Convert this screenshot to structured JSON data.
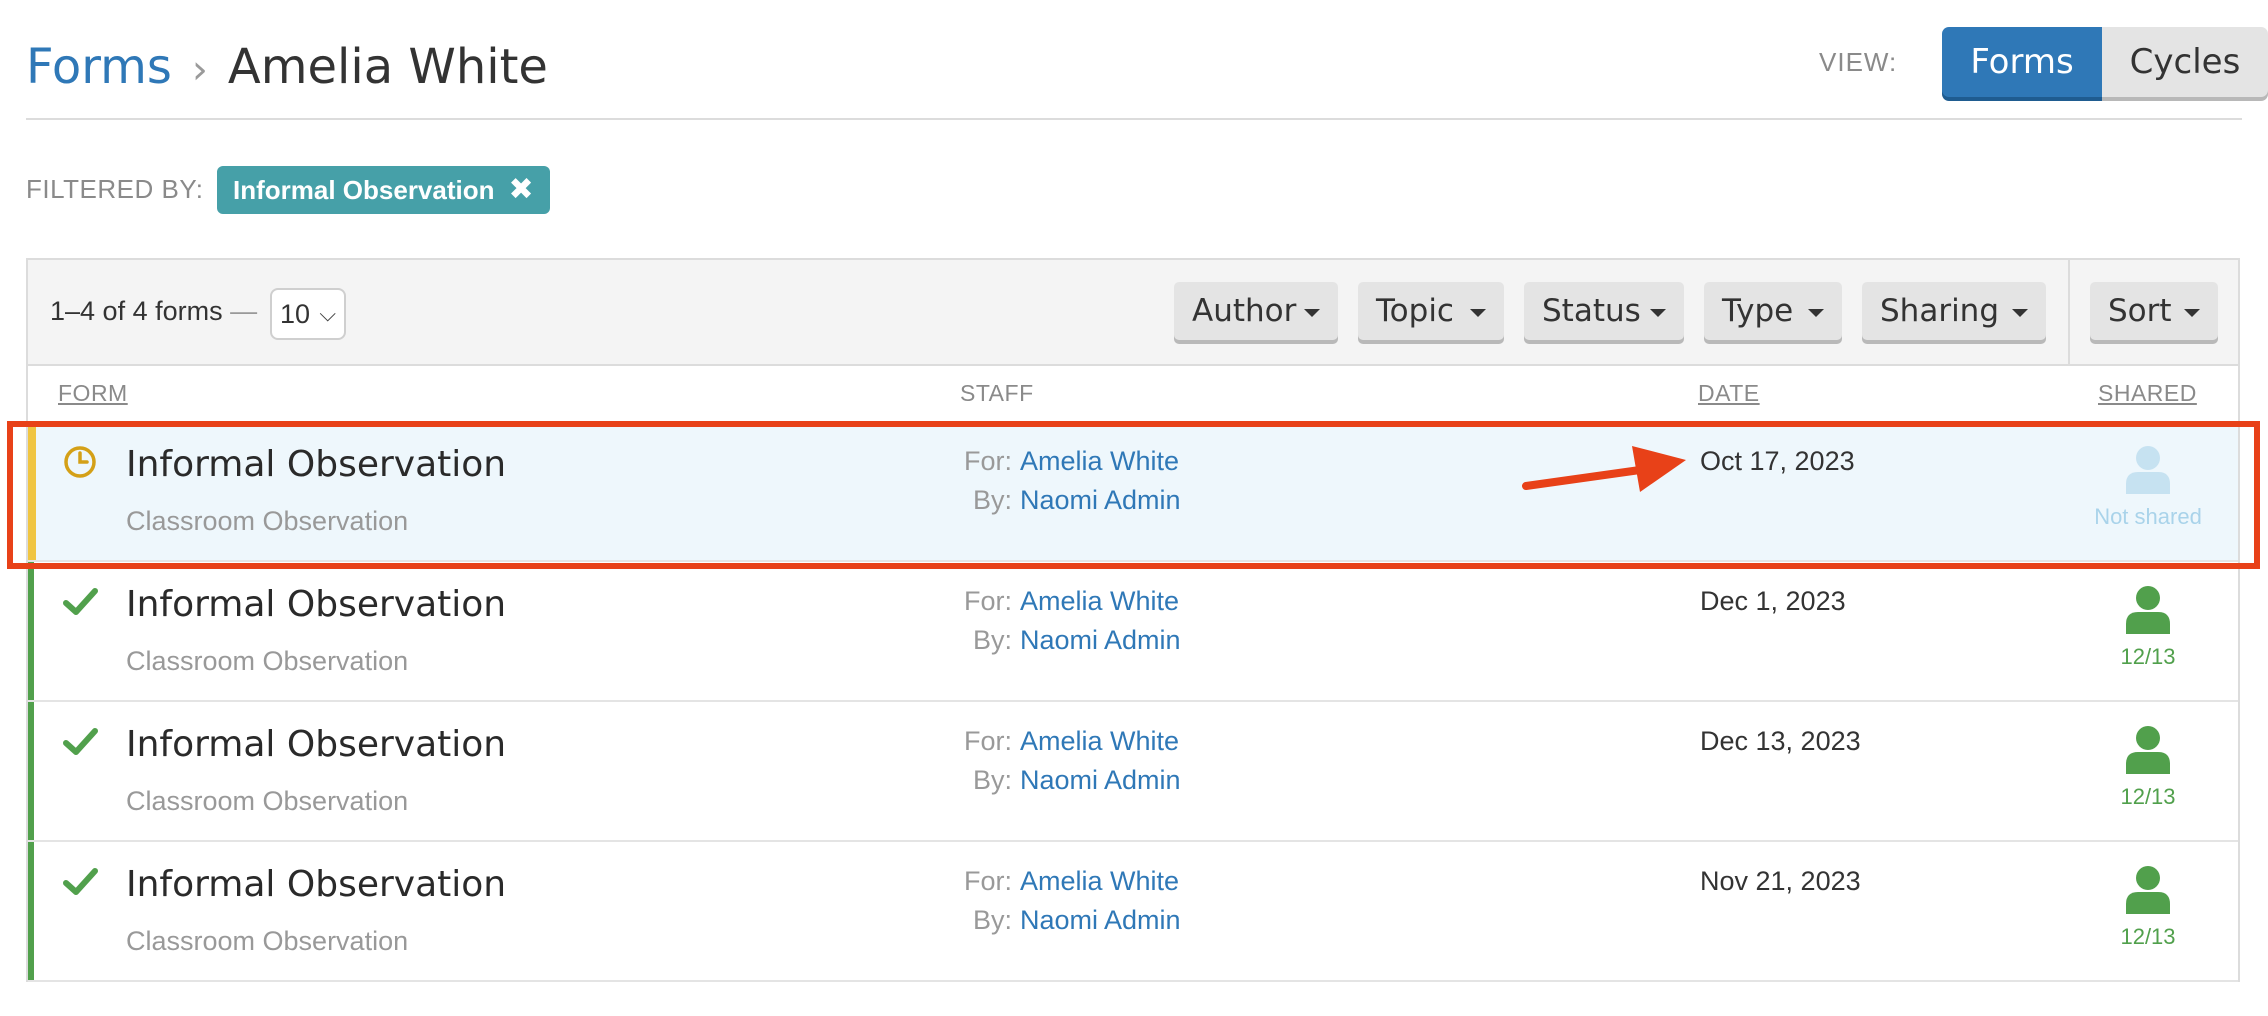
{
  "breadcrumb": {
    "root": "Forms",
    "separator": "›",
    "current": "Amelia White"
  },
  "view": {
    "label": "VIEW:",
    "options": [
      "Forms",
      "Cycles"
    ],
    "active": "Forms"
  },
  "filter": {
    "label": "FILTERED BY:",
    "chip": "Informal Observation",
    "chip_remove": "✖"
  },
  "toolbar": {
    "count_text": "1–4 of 4 forms",
    "count_dash": "—",
    "per_page": "10",
    "filters": [
      "Author",
      "Topic",
      "Status",
      "Type",
      "Sharing"
    ],
    "sort": "Sort"
  },
  "columns": {
    "form": "FORM",
    "staff": "STAFF",
    "date": "DATE",
    "shared": "SHARED"
  },
  "labels": {
    "for": "For:",
    "by": "By:"
  },
  "rows": [
    {
      "status": "pending",
      "status_icon": "clock-icon",
      "title": "Informal Observation",
      "subtitle": "Classroom Observation",
      "for": "Amelia White",
      "by": "Naomi Admin",
      "date": "Oct 17, 2023",
      "shared_icon": "user-icon",
      "shared_text": "Not shared"
    },
    {
      "status": "complete",
      "status_icon": "checkmark-icon",
      "title": "Informal Observation",
      "subtitle": "Classroom Observation",
      "for": "Amelia White",
      "by": "Naomi Admin",
      "date": "Dec 1, 2023",
      "shared_icon": "user-icon",
      "shared_text": "12/13"
    },
    {
      "status": "complete",
      "status_icon": "checkmark-icon",
      "title": "Informal Observation",
      "subtitle": "Classroom Observation",
      "for": "Amelia White",
      "by": "Naomi Admin",
      "date": "Dec 13, 2023",
      "shared_icon": "user-icon",
      "shared_text": "12/13"
    },
    {
      "status": "complete",
      "status_icon": "checkmark-icon",
      "title": "Informal Observation",
      "subtitle": "Classroom Observation",
      "for": "Amelia White",
      "by": "Naomi Admin",
      "date": "Nov 21, 2023",
      "shared_icon": "user-icon",
      "shared_text": "12/13"
    }
  ],
  "colors": {
    "primary": "#2f78b7",
    "filter_chip": "#46a0a8",
    "complete": "#51a04c",
    "pending": "#f0c542",
    "pending_icon": "#d4a017",
    "annotation": "#e84118"
  }
}
